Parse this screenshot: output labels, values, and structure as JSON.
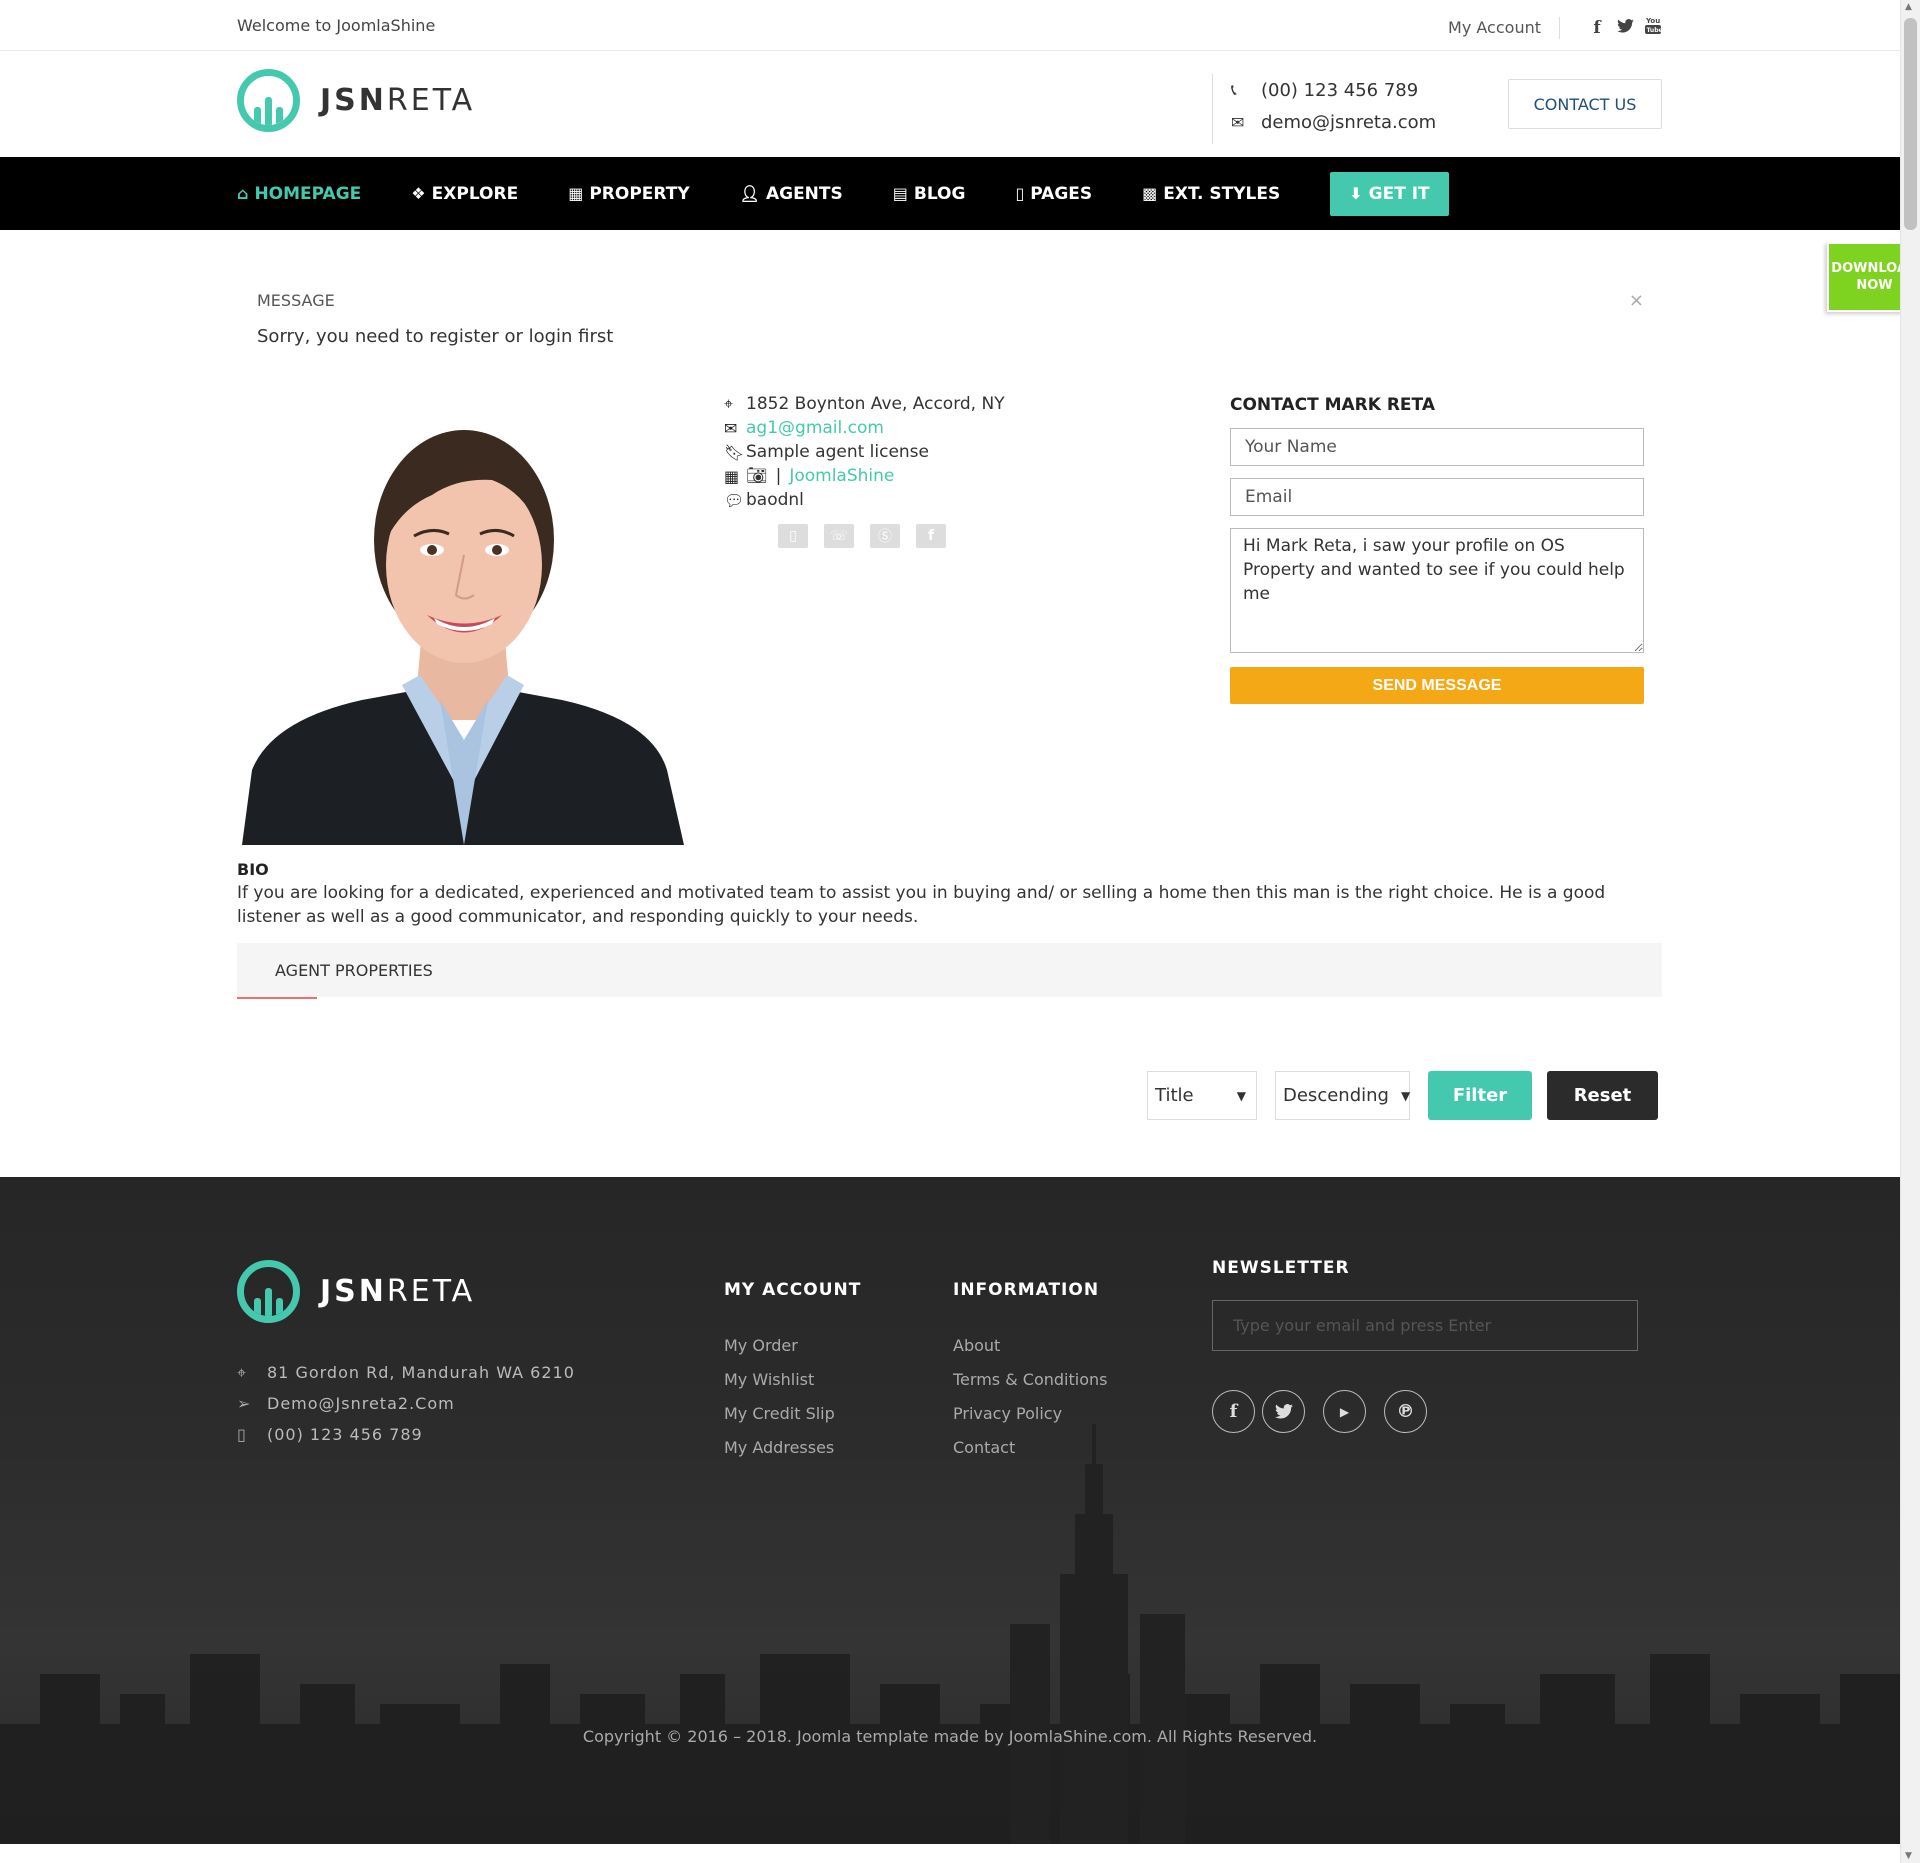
{
  "topbar": {
    "welcome": "Welcome to JoomlaShine",
    "my_account": "My Account",
    "social_icons": [
      "facebook-icon",
      "twitter-icon",
      "youtube-icon"
    ]
  },
  "header": {
    "logo_bold": "JSN",
    "logo_light": "RETA",
    "phone": "(00) 123 456 789",
    "email": "demo@jsnreta.com",
    "contact_button": "CONTACT US"
  },
  "nav": {
    "items": [
      {
        "label": "HOMEPAGE",
        "icon": "home-icon"
      },
      {
        "label": "EXPLORE",
        "icon": "cubes-icon"
      },
      {
        "label": "PROPERTY",
        "icon": "building-icon"
      },
      {
        "label": "AGENTS",
        "icon": "user-icon"
      },
      {
        "label": "BLOG",
        "icon": "newspaper-icon"
      },
      {
        "label": "PAGES",
        "icon": "file-icon"
      },
      {
        "label": "EXT. STYLES",
        "icon": "grid-icon"
      },
      {
        "label": "GET IT",
        "icon": "download-icon"
      }
    ]
  },
  "download_now": {
    "line1": "DOWNLOAD",
    "line2": "NOW"
  },
  "message": {
    "title": "MESSAGE",
    "text": "Sorry, you need to register or login first",
    "close": "×"
  },
  "agent": {
    "address": "1852 Boynton Ave, Accord, NY",
    "email": "ag1@gmail.com",
    "license": "Sample agent license",
    "company_separator": "|",
    "company": "JoomlaShine",
    "skype": "baodnl",
    "social_icons": [
      "mobile-icon",
      "phone-icon",
      "skype-icon",
      "facebook-icon"
    ]
  },
  "contact_form": {
    "title": "CONTACT MARK RETA",
    "name_placeholder": "Your Name",
    "email_placeholder": "Email",
    "message_value": "Hi Mark Reta, i saw your profile on OS Property and wanted to see if you could help me",
    "send_label": "SEND MESSAGE"
  },
  "bio": {
    "title": "BIO",
    "text": "If you are looking for a dedicated, experienced and motivated team to assist you in buying and/ or selling a home then this man is the right choice. He is a good listener as well as a good communicator, and responding quickly to your needs."
  },
  "tabs": {
    "agent_properties": "AGENT PROPERTIES"
  },
  "filter": {
    "order_by": "Title",
    "direction": "Descending",
    "filter_label": "Filter",
    "reset_label": "Reset"
  },
  "footer": {
    "address": "81 Gordon Rd, Mandurah WA 6210",
    "email": "Demo@Jsnreta2.Com",
    "phone": "(00) 123 456 789",
    "my_account": {
      "title": "MY ACCOUNT",
      "items": [
        "My Order",
        "My Wishlist",
        "My Credit Slip",
        "My Addresses"
      ]
    },
    "information": {
      "title": "INFORMATION",
      "items": [
        "About",
        "Terms & Conditions",
        "Privacy Policy",
        "Contact"
      ]
    },
    "newsletter": {
      "title": "NEWSLETTER",
      "placeholder": "Type your email and press Enter"
    },
    "social_icons": [
      "facebook-icon",
      "twitter-icon",
      "youtube-icon",
      "pinterest-icon"
    ],
    "copyright": "Copyright © 2016 – 2018. Joomla template made by JoomlaShine.com. All Rights Reserved."
  },
  "colors": {
    "accent": "#45c9ae",
    "send_button": "#f5a815",
    "download_badge": "#7ed321",
    "nav_bg": "#000000",
    "reset_button": "#2b2b2b"
  }
}
